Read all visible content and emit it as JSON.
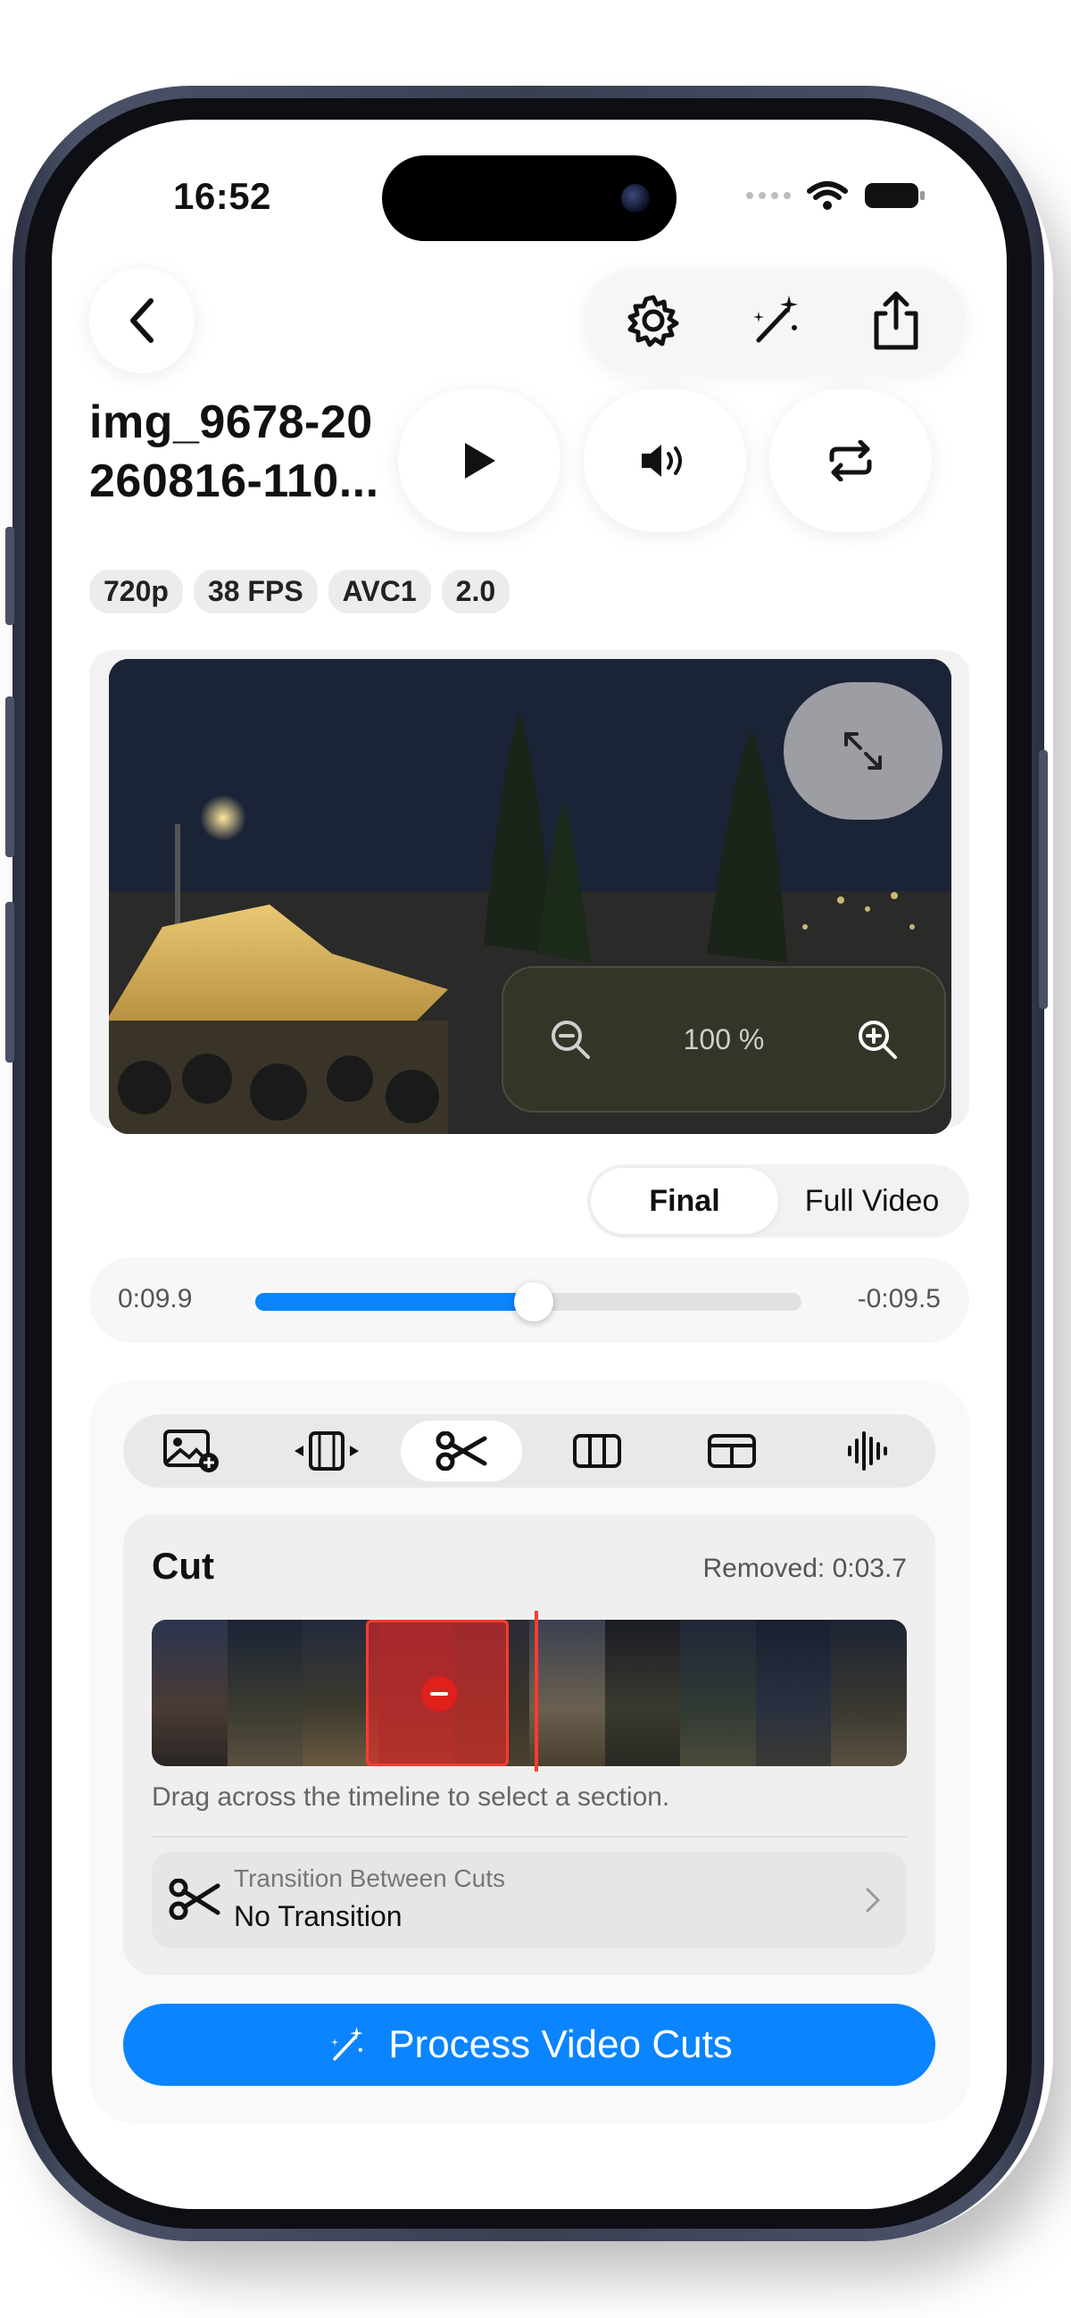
{
  "status_bar": {
    "time": "16:52"
  },
  "header": {
    "title": "img_9678-20 260816-110...",
    "badges": [
      "720p",
      "38 FPS",
      "AVC1",
      "2.0"
    ]
  },
  "player": {
    "zoom_label": "100 %"
  },
  "view_toggle": {
    "options": [
      "Final",
      "Full Video"
    ],
    "selected": "Final"
  },
  "timeline": {
    "elapsed": "0:09.9",
    "remaining": "-0:09.5",
    "progress": 0.51
  },
  "cut": {
    "title": "Cut",
    "removed": "Removed: 0:03.7",
    "hint": "Drag across the timeline to select a section.",
    "transition_label": "Transition Between Cuts",
    "transition_value": "No Transition"
  },
  "process_button": {
    "label": "Process Video Cuts"
  },
  "colors": {
    "accent": "#0a84ff",
    "selection": "#ff3b30"
  },
  "icons": [
    "back-icon",
    "settings-icon",
    "magic-wand-icon",
    "share-icon",
    "play-icon",
    "volume-icon",
    "loop-icon",
    "fullscreen-icon",
    "zoom-out-icon",
    "zoom-in-icon",
    "add-image-icon",
    "trim-icon",
    "scissors-icon",
    "columns-icon",
    "layout-icon",
    "waveform-icon",
    "chevron-right-icon"
  ]
}
